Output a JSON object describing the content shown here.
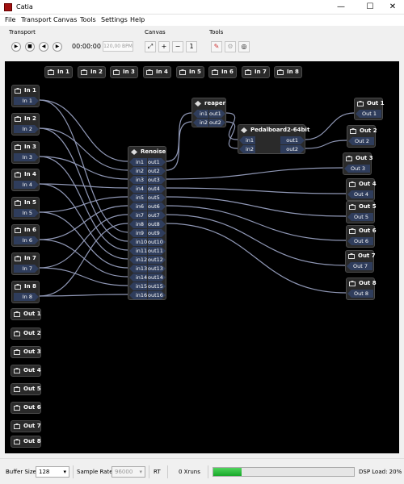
{
  "window": {
    "title": "Catia",
    "minimize": "—",
    "maximize": "☐",
    "close": "✕"
  },
  "menu": [
    "File",
    "Transport",
    "Canvas",
    "Tools",
    "Settings",
    "Help"
  ],
  "toolbar": {
    "transport_label": "Transport",
    "canvas_label": "Canvas",
    "tools_label": "Tools",
    "time": "00:00:00",
    "bpm": "120,00 BPM"
  },
  "colors": {
    "wire": "#8f97b5",
    "port": "#2f3d5c",
    "node_bg": "#2a2a2a",
    "canvas_bg": "#000000",
    "dsp_fill": "#2cc03a"
  },
  "nodes": {
    "top_in": [
      "In 1",
      "In 2",
      "In 3",
      "In 4",
      "In 5",
      "In 6",
      "In 7",
      "In 8"
    ],
    "left_in": [
      {
        "title": "In 1",
        "port": "In 1"
      },
      {
        "title": "In 2",
        "port": "In 2"
      },
      {
        "title": "In 3",
        "port": "In 3"
      },
      {
        "title": "In 4",
        "port": "In 4"
      },
      {
        "title": "In 5",
        "port": "In 5"
      },
      {
        "title": "In 6",
        "port": "In 6"
      },
      {
        "title": "In 7",
        "port": "In 7"
      },
      {
        "title": "In 8",
        "port": "In 8"
      }
    ],
    "left_out": [
      "Out 1",
      "Out 2",
      "Out 3",
      "Out 4",
      "Out 5",
      "Out 6",
      "Out 7",
      "Out 8"
    ],
    "renoise": {
      "title": "Renoise",
      "ins": [
        "in1",
        "in2",
        "in3",
        "in4",
        "in5",
        "in6",
        "in7",
        "in8",
        "in9",
        "in10",
        "in11",
        "in12",
        "in13",
        "in14",
        "in15",
        "in16"
      ],
      "outs": [
        "out1",
        "out2",
        "out3",
        "out4",
        "out5",
        "out6",
        "out7",
        "out8",
        "out9",
        "out10",
        "out11",
        "out12",
        "out13",
        "out14",
        "out15",
        "out16"
      ]
    },
    "reaper": {
      "title": "reaper",
      "ins": [
        "in1",
        "in2"
      ],
      "outs": [
        "out1",
        "out2"
      ]
    },
    "pedalboard": {
      "title": "Pedalboard2-64bit",
      "ins": [
        "in1",
        "in2"
      ],
      "outs": [
        "out1",
        "out2"
      ]
    },
    "right_out": [
      {
        "title": "Out 1",
        "port": "Out 1"
      },
      {
        "title": "Out 2",
        "port": "Out 2"
      },
      {
        "title": "Out 3",
        "port": "Out 3"
      },
      {
        "title": "Out 4",
        "port": "Out 4"
      },
      {
        "title": "Out 5",
        "port": "Out 5"
      },
      {
        "title": "Out 6",
        "port": "Out 6"
      },
      {
        "title": "Out 7",
        "port": "Out 7"
      },
      {
        "title": "Out 8",
        "port": "Out 8"
      }
    ]
  },
  "status": {
    "buffer_label": "Buffer Size:",
    "buffer_value": "128",
    "sample_rate_label": "Sample Rate:",
    "sample_rate_value": "96000",
    "rt": "RT",
    "xruns": "0 Xruns",
    "dsp_label": "DSP Load: 20%",
    "dsp_load": 0.2
  }
}
